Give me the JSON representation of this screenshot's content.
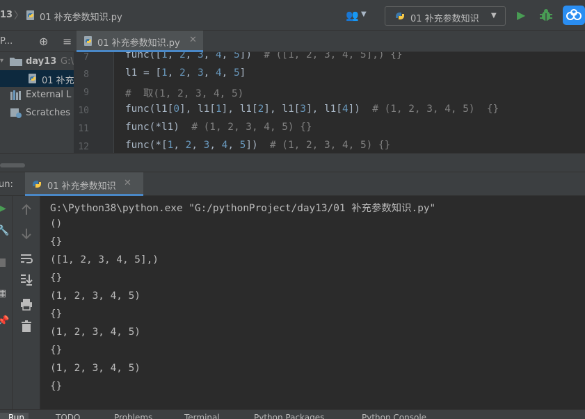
{
  "breadcrumb": {
    "folder": "13",
    "file": "01 补充参数知识.py"
  },
  "run_config": {
    "label": "01 补充参数知识"
  },
  "project_panel": {
    "title": "P...",
    "tree": [
      {
        "label": "day13",
        "hint": "G:\\"
      },
      {
        "label": "01 补充"
      },
      {
        "label": "External L"
      },
      {
        "label": "Scratches"
      }
    ]
  },
  "editor": {
    "tab_label": "01 补充参数知识.py",
    "line_numbers": [
      "7",
      "8",
      "9",
      "10",
      "11",
      "12"
    ]
  },
  "run_panel": {
    "label": "un:",
    "tab_label": "01 补充参数知识",
    "command": "G:\\Python38\\python.exe \"G:/pythonProject/day13/01 补充参数知识.py\"",
    "output": [
      "()",
      "{}",
      "([1, 2, 3, 4, 5],)",
      "{}",
      "(1, 2, 3, 4, 5)",
      "{}",
      "(1, 2, 3, 4, 5)",
      "{}",
      "(1, 2, 3, 4, 5)",
      "{}"
    ]
  },
  "bottom_bar": [
    "Run",
    "TODO",
    "Problems",
    "Terminal",
    "Python Packages",
    "Python Console"
  ],
  "colors": {
    "accent": "#4a88c7",
    "number": "#6897bb",
    "comment": "#808080",
    "run_green": "#499c54"
  }
}
